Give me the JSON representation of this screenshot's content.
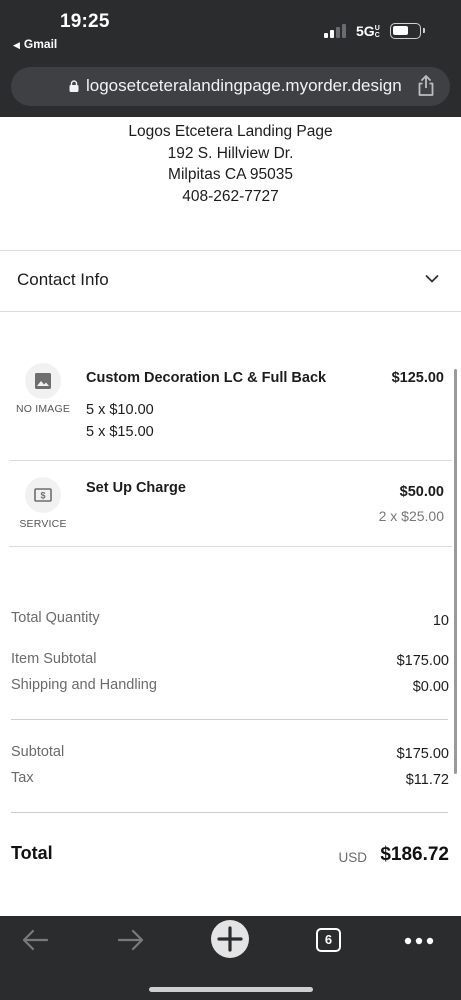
{
  "status_bar": {
    "time": "19:25",
    "back_app": "Gmail",
    "network": "5G",
    "network_suffix": "UC"
  },
  "browser": {
    "url": "logosetceteralandingpage.myorder.design",
    "tab_count": "6"
  },
  "store": {
    "name": "Logos Etcetera Landing Page",
    "street": "192 S. Hillview Dr.",
    "city_line": "Milpitas CA 95035",
    "phone": "408-262-7727"
  },
  "contact": {
    "label": "Contact Info"
  },
  "items": [
    {
      "icon": "image-icon",
      "icon_caption": "NO IMAGE",
      "name": "Custom Decoration LC & Full Back",
      "price": "$125.00",
      "lines": [
        "5 x $10.00",
        "5 x $15.00"
      ]
    },
    {
      "icon": "dollar-bill-icon",
      "icon_caption": "SERVICE",
      "name": "Set Up Charge",
      "price": "$50.00",
      "qty_line": "2 x $25.00"
    }
  ],
  "summary": {
    "total_quantity_label": "Total Quantity",
    "total_quantity": "10",
    "item_subtotal_label": "Item Subtotal",
    "item_subtotal": "$175.00",
    "shipping_label": "Shipping and Handling",
    "shipping": "$0.00",
    "subtotal_label": "Subtotal",
    "subtotal": "$175.00",
    "tax_label": "Tax",
    "tax": "$11.72",
    "total_label": "Total",
    "currency": "USD",
    "total": "$186.72"
  }
}
